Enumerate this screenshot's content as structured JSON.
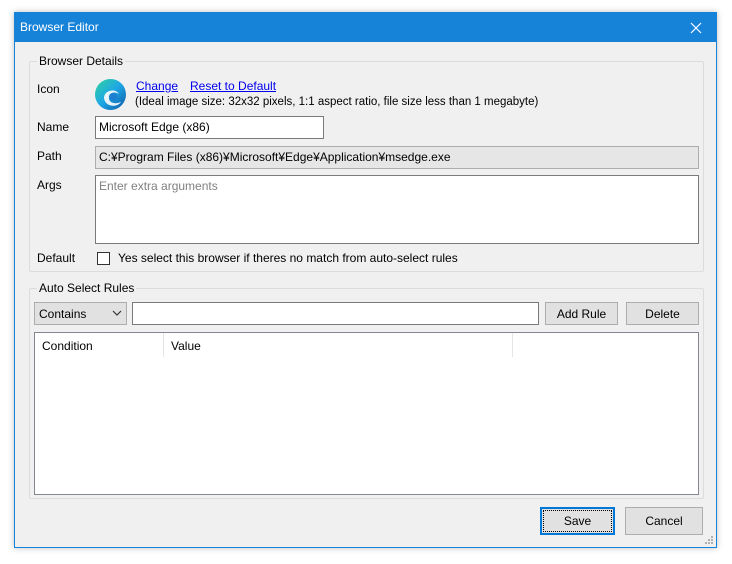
{
  "window": {
    "title": "Browser Editor"
  },
  "details": {
    "group_label": "Browser Details",
    "icon_label": "Icon",
    "change_link": "Change",
    "reset_link": "Reset to Default",
    "icon_hint": "(Ideal image size: 32x32 pixels, 1:1 aspect ratio, file size less than 1 megabyte)",
    "name_label": "Name",
    "name_value": "Microsoft Edge (x86)",
    "path_label": "Path",
    "path_value": "C:¥Program Files (x86)¥Microsoft¥Edge¥Application¥msedge.exe",
    "args_label": "Args",
    "args_placeholder": "Enter extra arguments",
    "default_label": "Default",
    "default_checkbox_text": "Yes select this browser if theres no match from auto-select rules",
    "default_checked": false
  },
  "rules": {
    "group_label": "Auto Select Rules",
    "match_type_selected": "Contains",
    "rule_value": "",
    "add_button": "Add Rule",
    "delete_button": "Delete",
    "columns": [
      "Condition",
      "Value"
    ]
  },
  "footer": {
    "save_button": "Save",
    "cancel_button": "Cancel"
  },
  "colors": {
    "titlebar": "#1783d8",
    "link": "#0000ee",
    "focus_border": "#0078d7"
  },
  "icons": {
    "close": "close-icon",
    "browser": "edge-icon",
    "dropdown": "chevron-down-icon",
    "grip": "resize-grip-icon"
  }
}
